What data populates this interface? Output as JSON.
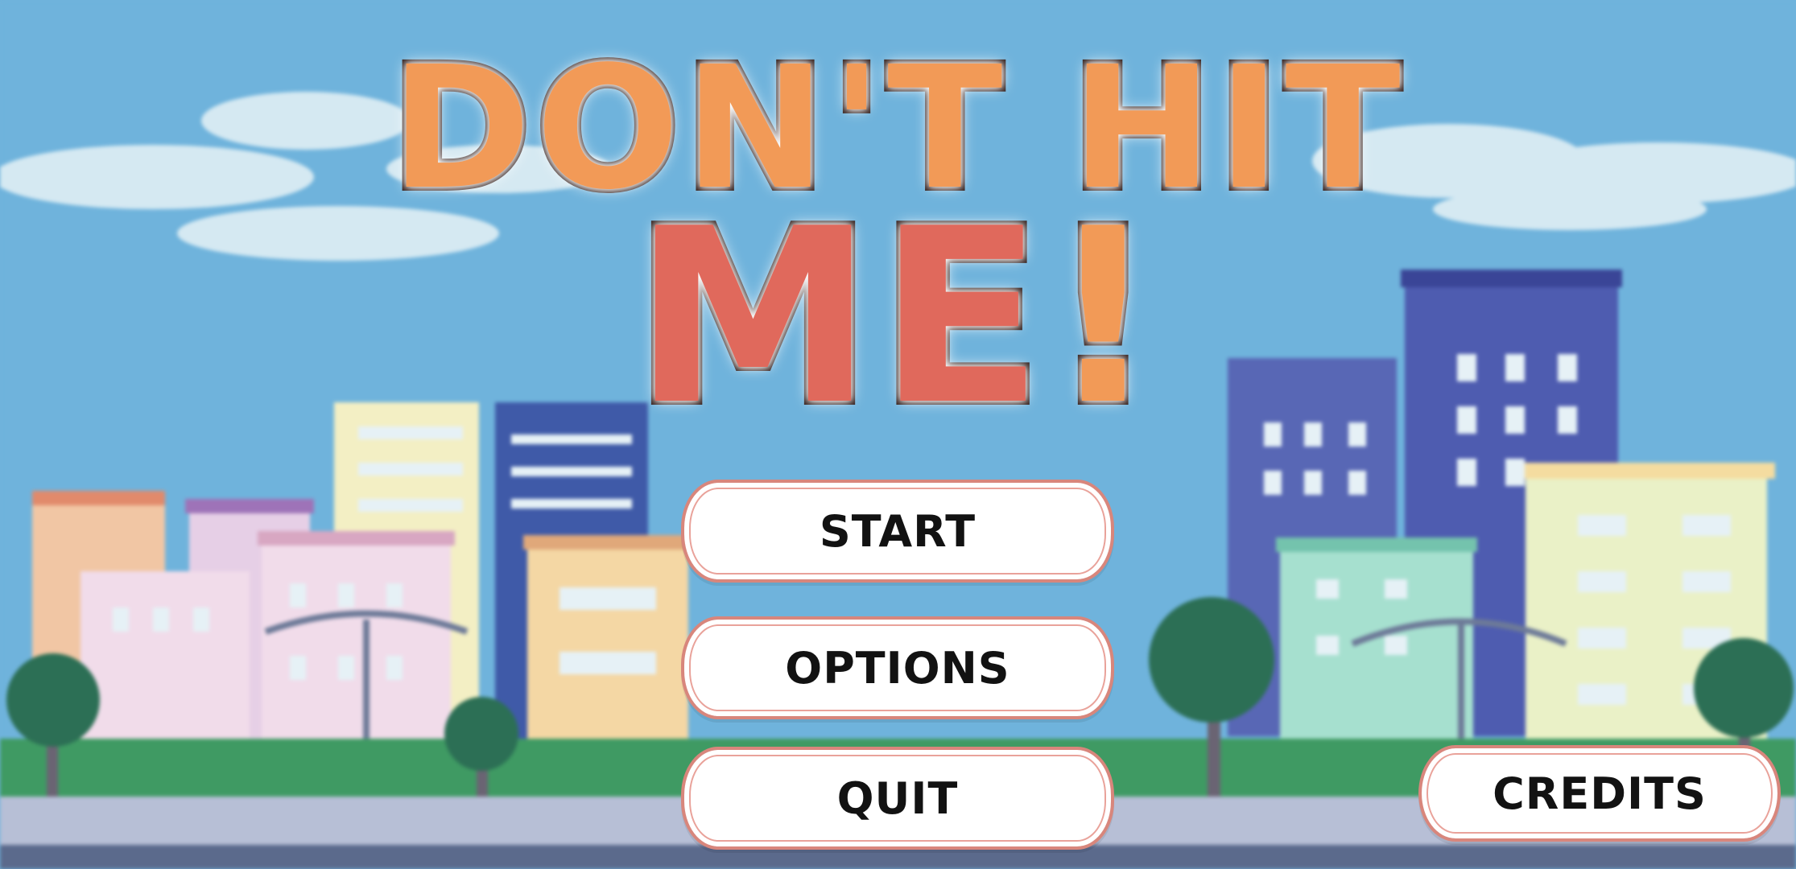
{
  "title": {
    "line1": "DON'T HIT",
    "line2_word": "ME",
    "line2_mark": "!"
  },
  "menu": {
    "start": "START",
    "options": "OPTIONS",
    "quit": "QUIT",
    "credits": "CREDITS"
  },
  "colors": {
    "sky": "#6fb3dc",
    "title_orange": "#f29a57",
    "title_red": "#e0695c",
    "button_border": "#d8867c"
  }
}
